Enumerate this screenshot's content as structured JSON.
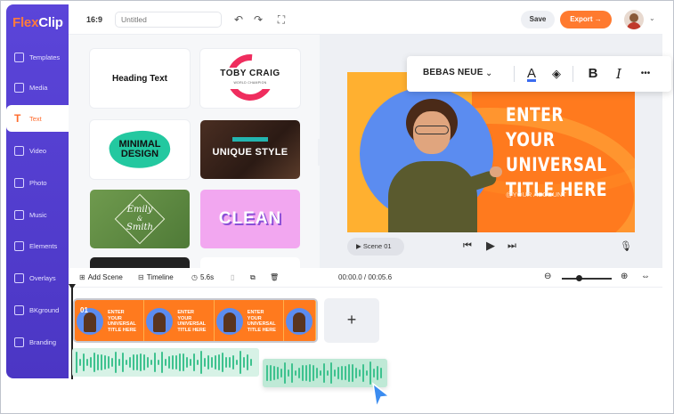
{
  "app": {
    "logo_flex": "Flex",
    "logo_clip": "Clip"
  },
  "topbar": {
    "ratio": "16:9",
    "title_placeholder": "Untitled",
    "save_label": "Save",
    "export_label": "Export →"
  },
  "sidebar": {
    "items": [
      {
        "label": "Templates",
        "icon": "layers-icon"
      },
      {
        "label": "Media",
        "icon": "folder-icon"
      },
      {
        "label": "Text",
        "icon": "text-icon",
        "active": true
      },
      {
        "label": "Video",
        "icon": "video-icon"
      },
      {
        "label": "Photo",
        "icon": "photo-icon"
      },
      {
        "label": "Music",
        "icon": "music-icon"
      },
      {
        "label": "Elements",
        "icon": "elements-icon"
      },
      {
        "label": "Overlays",
        "icon": "overlays-icon"
      },
      {
        "label": "BKground",
        "icon": "background-icon"
      },
      {
        "label": "Branding",
        "icon": "branding-icon"
      }
    ]
  },
  "templates": {
    "heading": "Heading Text",
    "toby": "TOBY CRAIG",
    "toby_sub": "WORLD CHAMPION",
    "minimal_1": "MINIMAL",
    "minimal_2": "DESIGN",
    "unique": "UNIQUE STYLE",
    "emily_1": "Emily",
    "emily_2": "&",
    "emily_3": "Smith",
    "clean": "CLEAN"
  },
  "text_toolbar": {
    "font": "BEBAS NEUE",
    "bold": "B",
    "italic": "I",
    "more": "•••"
  },
  "scene": {
    "title_line1": "ENTER YOUR",
    "title_line2": "UNIVERSAL",
    "title_line3": "TITLE HERE",
    "account": "@YOUR ACCOUNT",
    "chip_label": "Scene 01"
  },
  "timeline": {
    "add_scene": "Add Scene",
    "timeline_label": "Timeline",
    "duration": "5.6s",
    "time": "00:00.0 / 00:05.6",
    "clip_number": "01",
    "thumb_text": "ENTER YOUR UNIVERSAL TITLE HERE",
    "add_button": "+"
  },
  "colors": {
    "sidebar": "#5b45d9",
    "accent": "#ff7a2f",
    "scene_bg": "#ff7a1e",
    "audio": "#3ec28f"
  }
}
